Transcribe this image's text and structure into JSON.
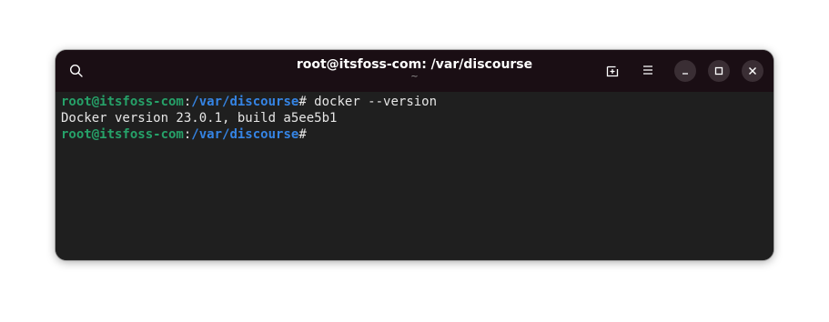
{
  "window": {
    "title": "root@itsfoss-com: /var/discourse",
    "subtitle": "~"
  },
  "titlebar": {
    "icons": [
      "search-icon",
      "new-tab-icon",
      "menu-icon",
      "minimize-icon",
      "maximize-icon",
      "close-icon"
    ]
  },
  "terminal": {
    "lines": [
      {
        "user": "root@itsfoss-com",
        "sep": ":",
        "path": "/var/discourse",
        "prompt": "#",
        "command": " docker --version"
      },
      {
        "output": "Docker version 23.0.1, build a5ee5b1"
      },
      {
        "user": "root@itsfoss-com",
        "sep": ":",
        "path": "/var/discourse",
        "prompt": "#",
        "command": ""
      }
    ]
  },
  "colors": {
    "titlebar_bg": "#1a0e14",
    "terminal_bg": "#1f1f1f",
    "user_green": "#26a269",
    "path_blue": "#3584e4",
    "text": "#e6e6e6"
  }
}
